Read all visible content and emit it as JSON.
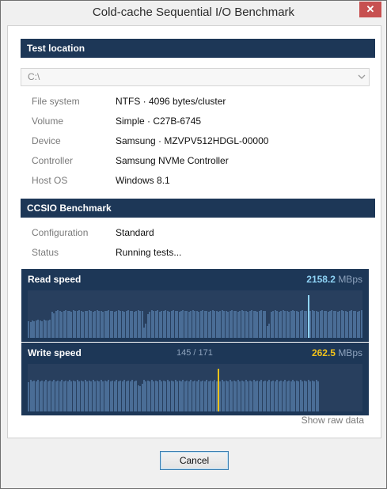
{
  "window": {
    "title": "Cold-cache Sequential I/O Benchmark",
    "close_glyph": "✕"
  },
  "location": {
    "header": "Test location",
    "drive": "C:\\",
    "rows": [
      {
        "label": "File system",
        "value": "NTFS  ·  4096 bytes/cluster"
      },
      {
        "label": "Volume",
        "value": "Simple  ·  C27B-6745"
      },
      {
        "label": "Device",
        "value": "Samsung  ·  MZVPV512HDGL-00000"
      },
      {
        "label": "Controller",
        "value": "Samsung NVMe Controller"
      },
      {
        "label": "Host OS",
        "value": "Windows 8.1"
      }
    ]
  },
  "benchmark": {
    "header": "CCSIO Benchmark",
    "rows": [
      {
        "label": "Configuration",
        "value": "Standard"
      },
      {
        "label": "Status",
        "value": "Running tests..."
      }
    ]
  },
  "read_chart": {
    "title": "Read speed",
    "value": "2158.2",
    "unit": "MBps",
    "accent": "#8fd3f5",
    "bar_color": "#4a6d96"
  },
  "write_chart": {
    "title": "Write speed",
    "progress": "145 / 171",
    "value": "262.5",
    "unit": "MBps",
    "accent": "#f2c21b",
    "bar_color": "#4a6d96"
  },
  "chart_data": [
    {
      "type": "bar",
      "title": "Read speed",
      "unit": "MBps",
      "current_value": 2158.2,
      "total_samples": 171,
      "completed_samples": 171,
      "highlight_index": 143,
      "values_relative": [
        0.35,
        0.34,
        0.36,
        0.35,
        0.37,
        0.38,
        0.36,
        0.35,
        0.38,
        0.37,
        0.36,
        0.38,
        0.55,
        0.52,
        0.56,
        0.58,
        0.57,
        0.55,
        0.56,
        0.58,
        0.57,
        0.56,
        0.55,
        0.58,
        0.57,
        0.56,
        0.58,
        0.57,
        0.55,
        0.56,
        0.57,
        0.58,
        0.56,
        0.55,
        0.57,
        0.58,
        0.57,
        0.56,
        0.55,
        0.57,
        0.56,
        0.58,
        0.57,
        0.56,
        0.55,
        0.57,
        0.58,
        0.56,
        0.57,
        0.55,
        0.56,
        0.58,
        0.57,
        0.56,
        0.55,
        0.57,
        0.58,
        0.56,
        0.57,
        0.22,
        0.3,
        0.5,
        0.55,
        0.58,
        0.57,
        0.56,
        0.58,
        0.55,
        0.57,
        0.56,
        0.58,
        0.57,
        0.55,
        0.56,
        0.58,
        0.57,
        0.56,
        0.55,
        0.57,
        0.58,
        0.56,
        0.57,
        0.55,
        0.56,
        0.58,
        0.57,
        0.56,
        0.55,
        0.57,
        0.58,
        0.56,
        0.57,
        0.55,
        0.56,
        0.58,
        0.57,
        0.56,
        0.55,
        0.57,
        0.58,
        0.56,
        0.57,
        0.55,
        0.56,
        0.58,
        0.57,
        0.56,
        0.55,
        0.57,
        0.58,
        0.56,
        0.57,
        0.55,
        0.56,
        0.58,
        0.57,
        0.56,
        0.55,
        0.57,
        0.58,
        0.56,
        0.57,
        0.25,
        0.3,
        0.55,
        0.57,
        0.58,
        0.56,
        0.55,
        0.57,
        0.58,
        0.56,
        0.57,
        0.55,
        0.56,
        0.58,
        0.57,
        0.56,
        0.55,
        0.57,
        0.58,
        0.56,
        0.57,
        0.55,
        0.56,
        0.58,
        0.57,
        0.56,
        0.55,
        0.57,
        0.58,
        0.56,
        0.57,
        0.55,
        0.56,
        0.58,
        0.57,
        0.56,
        0.55,
        0.57,
        0.58,
        0.56,
        0.57,
        0.55,
        0.56,
        0.58,
        0.57,
        0.56,
        0.55,
        0.57,
        0.58,
        0.56,
        0.57,
        0.55,
        0.56
      ]
    },
    {
      "type": "bar",
      "title": "Write speed",
      "unit": "MBps",
      "current_value": 262.5,
      "total_samples": 171,
      "completed_samples": 145,
      "highlight_index": 97,
      "values_relative": [
        0.62,
        0.66,
        0.63,
        0.65,
        0.64,
        0.66,
        0.63,
        0.65,
        0.64,
        0.66,
        0.63,
        0.65,
        0.64,
        0.66,
        0.63,
        0.65,
        0.64,
        0.66,
        0.63,
        0.65,
        0.64,
        0.66,
        0.63,
        0.65,
        0.64,
        0.66,
        0.63,
        0.65,
        0.64,
        0.66,
        0.63,
        0.65,
        0.64,
        0.66,
        0.63,
        0.65,
        0.64,
        0.66,
        0.63,
        0.65,
        0.64,
        0.66,
        0.63,
        0.65,
        0.64,
        0.66,
        0.63,
        0.65,
        0.64,
        0.66,
        0.63,
        0.65,
        0.64,
        0.66,
        0.63,
        0.65,
        0.55,
        0.53,
        0.58,
        0.66,
        0.63,
        0.65,
        0.64,
        0.66,
        0.63,
        0.65,
        0.64,
        0.66,
        0.63,
        0.65,
        0.64,
        0.66,
        0.63,
        0.65,
        0.64,
        0.66,
        0.63,
        0.65,
        0.64,
        0.66,
        0.63,
        0.65,
        0.64,
        0.66,
        0.63,
        0.65,
        0.64,
        0.66,
        0.63,
        0.65,
        0.64,
        0.66,
        0.63,
        0.65,
        0.64,
        0.66,
        0.63,
        0.65,
        0.64,
        0.66,
        0.63,
        0.65,
        0.64,
        0.66,
        0.63,
        0.65,
        0.64,
        0.66,
        0.63,
        0.65,
        0.64,
        0.66,
        0.63,
        0.65,
        0.64,
        0.66,
        0.63,
        0.65,
        0.64,
        0.66,
        0.63,
        0.65,
        0.64,
        0.66,
        0.63,
        0.65,
        0.64,
        0.66,
        0.63,
        0.65,
        0.64,
        0.66,
        0.63,
        0.65,
        0.64,
        0.66,
        0.63,
        0.65,
        0.64,
        0.66,
        0.63,
        0.65,
        0.64,
        0.66,
        0.63,
        0.65,
        0.64,
        0.66,
        0.63
      ]
    }
  ],
  "footer": {
    "show_raw": "Show raw data",
    "cancel": "Cancel"
  }
}
